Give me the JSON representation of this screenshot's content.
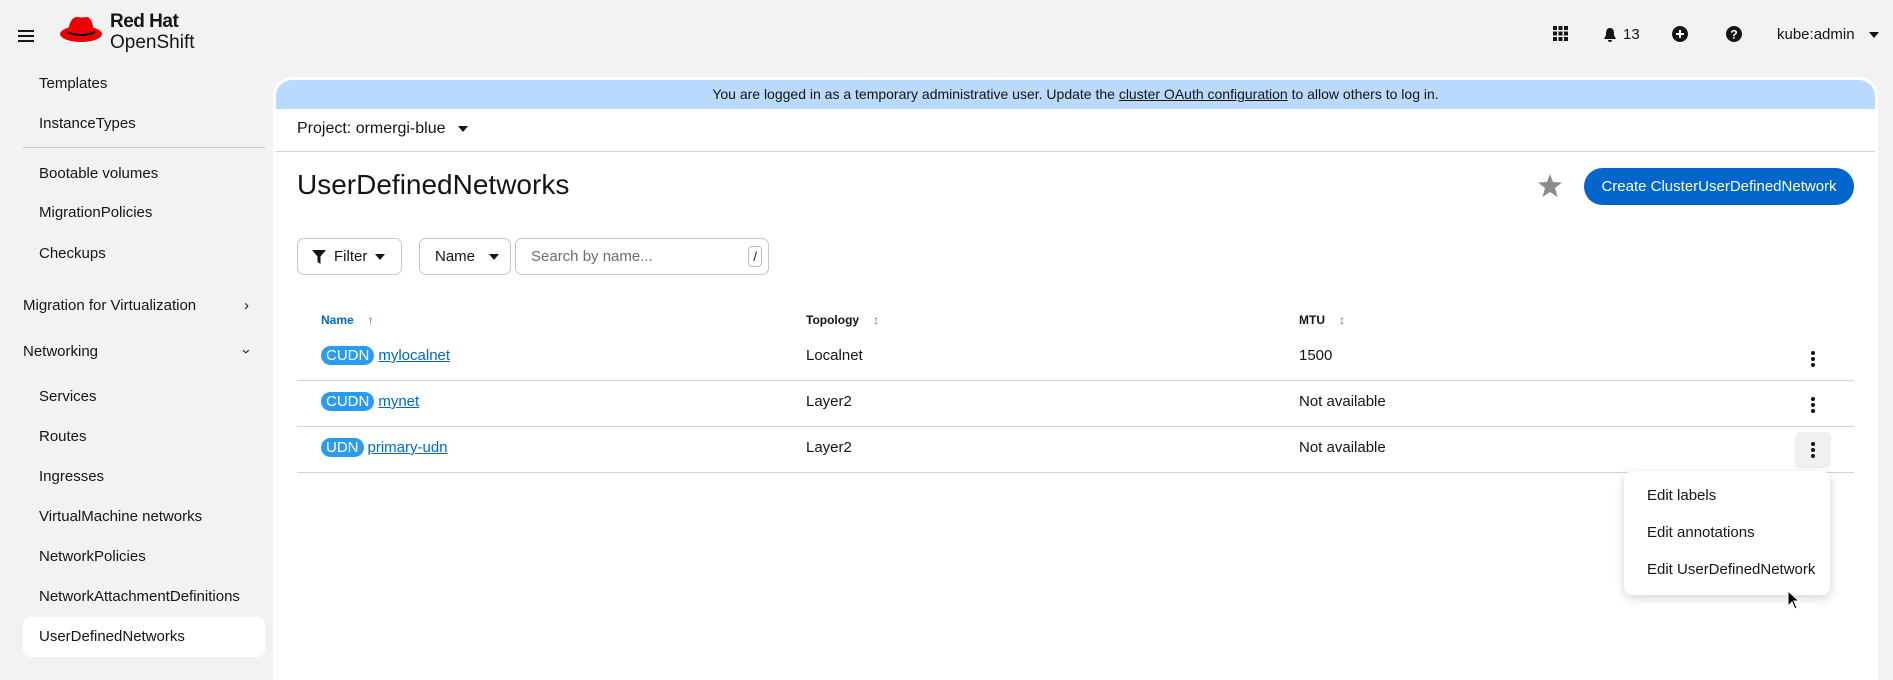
{
  "header": {
    "brand_line1": "Red Hat",
    "brand_line2": "OpenShift",
    "notifications_count": "13",
    "user": "kube:admin"
  },
  "sidebar": {
    "items": [
      {
        "label": "Templates"
      },
      {
        "label": "InstanceTypes"
      },
      {
        "label": "Bootable volumes"
      },
      {
        "label": "MigrationPolicies"
      },
      {
        "label": "Checkups"
      }
    ],
    "groups": [
      {
        "label": "Migration for Virtualization",
        "expanded": false
      },
      {
        "label": "Networking",
        "expanded": true
      }
    ],
    "networking_items": [
      {
        "label": "Services"
      },
      {
        "label": "Routes"
      },
      {
        "label": "Ingresses"
      },
      {
        "label": "VirtualMachine networks"
      },
      {
        "label": "NetworkPolicies"
      },
      {
        "label": "NetworkAttachmentDefinitions"
      },
      {
        "label": "UserDefinedNetworks",
        "selected": true
      }
    ]
  },
  "banner": {
    "prefix": "You are logged in as a temporary administrative user. Update the ",
    "link": "cluster OAuth configuration",
    "suffix": " to allow others to log in."
  },
  "project": {
    "label": "Project: ormergi-blue"
  },
  "page": {
    "title": "UserDefinedNetworks",
    "create_button": "Create ClusterUserDefinedNetwork"
  },
  "toolbar": {
    "filter": "Filter",
    "name_select": "Name",
    "search_placeholder": "Search by name...",
    "shortcut": "/"
  },
  "table": {
    "columns": [
      "Name",
      "Topology",
      "MTU"
    ],
    "rows": [
      {
        "badge": "CUDN",
        "name": "mylocalnet",
        "topology": "Localnet",
        "mtu": "1500"
      },
      {
        "badge": "CUDN",
        "name": "mynet",
        "topology": "Layer2",
        "mtu": "Not available"
      },
      {
        "badge": "UDN",
        "name": "primary-udn",
        "topology": "Layer2",
        "mtu": "Not available"
      }
    ]
  },
  "kebab_menu": {
    "items": [
      "Edit labels",
      "Edit annotations",
      "Edit UserDefinedNetwork"
    ]
  },
  "colors": {
    "primary": "#0066cc",
    "badge": "#2b9af3",
    "banner": "#b9dafc"
  }
}
